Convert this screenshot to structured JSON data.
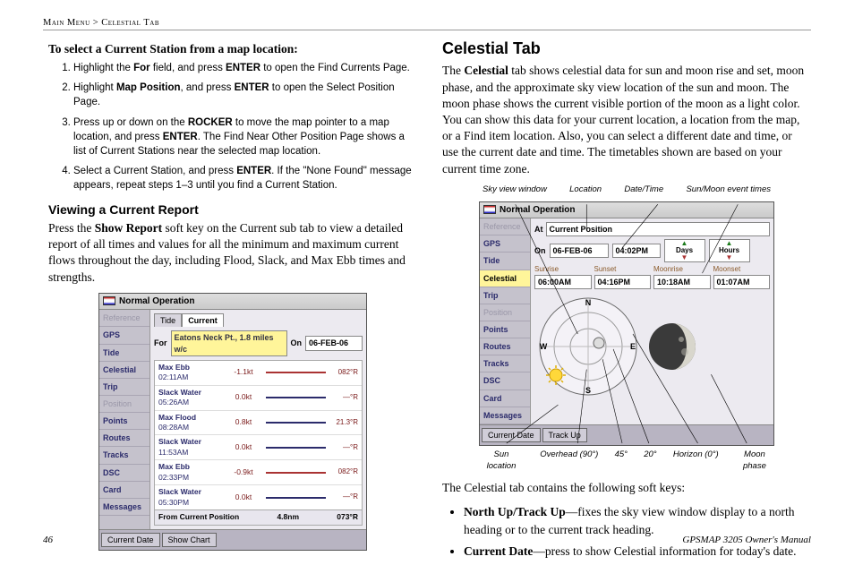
{
  "breadcrumb": "Main Menu > Celestial Tab",
  "left": {
    "subhead": "To select a Current Station from a map location:",
    "steps": [
      {
        "pre": "Highlight the ",
        "b1": "For",
        "mid": " field, and press ",
        "b2": "ENTER",
        "post": " to open the Find Currents Page."
      },
      {
        "pre": "Highlight ",
        "b1": "Map Position",
        "mid": ", and press ",
        "b2": "ENTER",
        "post": " to open the Select Position Page."
      },
      {
        "pre": "Press up or down on the ",
        "b1": "ROCKER",
        "mid": " to move the map pointer to a map location, and press ",
        "b2": "ENTER",
        "post": ". The Find Near Other Position Page shows a list of Current Stations near the selected map location."
      },
      {
        "pre": "Select a Current Station, and press ",
        "b1": "ENTER",
        "mid": ". If the \"None Found\" message appears, repeat steps 1–3 until you find a Current Station.",
        "b2": "",
        "post": ""
      }
    ],
    "viewhead": "Viewing a Current Report",
    "viewbody_a": "Press the ",
    "viewbody_b": "Show Report",
    "viewbody_c": " soft key on the Current sub tab to view a detailed report of all times and values for all the minimum and maximum current flows throughout the day, including Flood, Slack, and Max Ebb times and strengths."
  },
  "win_title": "Normal Operation",
  "sidebar_tabs": [
    "Reference",
    "GPS",
    "Tide",
    "Celestial",
    "Trip",
    "Position",
    "Points",
    "Routes",
    "Tracks",
    "DSC",
    "Card",
    "Messages"
  ],
  "leftfig": {
    "subtabs": [
      "Tide",
      "Current"
    ],
    "for_label": "For",
    "for_value": "Eatons Neck Pt., 1.8 miles w/c",
    "on_label": "On",
    "on_value": "06-FEB-06",
    "rows": [
      {
        "label": "Max Ebb",
        "time": "02:11AM",
        "val": "-1.1kt",
        "ft": "082°R",
        "redbar": true
      },
      {
        "label": "Slack Water",
        "time": "05:26AM",
        "val": "0.0kt",
        "ft": "—°R",
        "redbar": false
      },
      {
        "label": "Max Flood",
        "time": "08:28AM",
        "val": "0.8kt",
        "ft": "21.3°R",
        "redbar": false
      },
      {
        "label": "Slack Water",
        "time": "11:53AM",
        "val": "0.0kt",
        "ft": "—°R",
        "redbar": false
      },
      {
        "label": "Max Ebb",
        "time": "02:33PM",
        "val": "-0.9kt",
        "ft": "082°R",
        "redbar": true
      },
      {
        "label": "Slack Water",
        "time": "05:30PM",
        "val": "0.0kt",
        "ft": "—°R",
        "redbar": false
      }
    ],
    "from_label": "From Current Position",
    "from_dist": "4.8nm",
    "from_brg": "073°R",
    "softkeys": [
      "Current Date",
      "Show Chart"
    ]
  },
  "right": {
    "h2": "Celestial Tab",
    "p1_a": "The ",
    "p1_b": "Celestial",
    "p1_c": " tab shows celestial data for sun and moon rise and set, moon phase, and the approximate sky view location of the sun and moon. The moon phase shows the current visible portion of the moon as a light color. You can show this data for your current location, a location from the map, or a Find item location. Also, you can select a different date and time, or use the current date and time. The timetables shown are based on your current time zone.",
    "callouts": {
      "sky": "Sky view window",
      "loc": "Location",
      "dt": "Date/Time",
      "ev": "Sun/Moon event times",
      "sun": "Sun location",
      "ov": "Overhead (90°)",
      "a45": "45°",
      "a20": "20°",
      "hor": "Horizon (0°)",
      "moon": "Moon phase"
    },
    "p2": "The Celestial tab contains the following soft keys:",
    "bullets": [
      {
        "b": "North Up/Track Up",
        "t": "—fixes the sky view window display to a north heading or to the current track heading."
      },
      {
        "b": "Current Date",
        "t": "—press to show Celestial information for today's date."
      }
    ]
  },
  "rightfig": {
    "at_label": "At",
    "at_value": "Current Position",
    "on_label": "On",
    "on_date": "06-FEB-06",
    "on_time": "04:02PM",
    "days": "Days",
    "hours": "Hours",
    "rise": [
      {
        "lbl": "Sunrise",
        "val": "06:00AM"
      },
      {
        "lbl": "Sunset",
        "val": "04:16PM"
      },
      {
        "lbl": "Moonrise",
        "val": "10:18AM"
      },
      {
        "lbl": "Moonset",
        "val": "01:07AM"
      }
    ],
    "compass": {
      "n": "N",
      "s": "S",
      "e": "E",
      "w": "W"
    },
    "softkeys": [
      "Current Date",
      "Track Up"
    ]
  },
  "page_num": "46",
  "manual": "GPSMAP 3205 Owner's Manual"
}
